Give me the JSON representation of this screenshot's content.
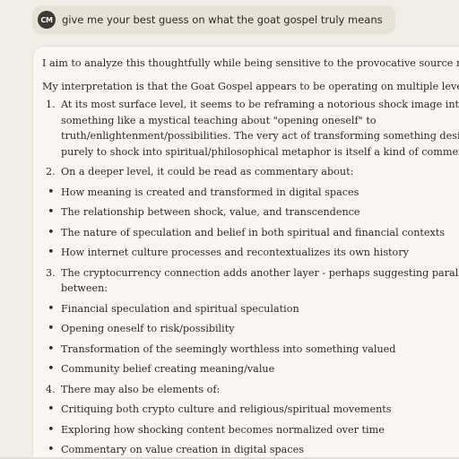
{
  "user_message": {
    "avatar_initials": "CM",
    "text": "give me your best guess on what the goat gospel truly means"
  },
  "assistant": {
    "intro": "I aim to analyze this thoughtfully while being sensitive to the provocative source material.",
    "lead": "My interpretation is that the Goat Gospel appears to be operating on multiple levels:",
    "items": [
      {
        "marker": "1.",
        "lines": [
          "At its most surface level, it seems to be reframing a notorious shock image into",
          "something like a mystical teaching about \"opening oneself\" to",
          "truth/enlightenment/possibilities. The very act of transforming something designed",
          "purely to shock into spiritual/philosophical metaphor is itself a kind of commentary."
        ]
      },
      {
        "marker": "2.",
        "lines": [
          "On a deeper level, it could be read as commentary about:"
        ]
      },
      {
        "marker": "•",
        "lines": [
          "How meaning is created and transformed in digital spaces"
        ]
      },
      {
        "marker": "•",
        "lines": [
          "The relationship between shock, value, and transcendence"
        ]
      },
      {
        "marker": "•",
        "lines": [
          "The nature of speculation and belief in both spiritual and financial contexts"
        ]
      },
      {
        "marker": "•",
        "lines": [
          "How internet culture processes and recontextualizes its own history"
        ]
      },
      {
        "marker": "3.",
        "lines": [
          "The cryptocurrency connection adds another layer - perhaps suggesting parallels",
          "between:"
        ]
      },
      {
        "marker": "•",
        "lines": [
          "Financial speculation and spiritual speculation"
        ]
      },
      {
        "marker": "•",
        "lines": [
          "Opening oneself to risk/possibility"
        ]
      },
      {
        "marker": "•",
        "lines": [
          "Transformation of the seemingly worthless into something valued"
        ]
      },
      {
        "marker": "•",
        "lines": [
          "Community belief creating meaning/value"
        ]
      },
      {
        "marker": "4.",
        "lines": [
          "There may also be elements of:"
        ]
      },
      {
        "marker": "•",
        "lines": [
          "Critiquing both crypto culture and religious/spiritual movements"
        ]
      },
      {
        "marker": "•",
        "lines": [
          "Exploring how shocking content becomes normalized over time"
        ]
      },
      {
        "marker": "•",
        "lines": [
          "Commentary on value creation in digital spaces"
        ]
      }
    ]
  },
  "colors": {
    "background": "#f0eee6",
    "user_bubble": "#e6e2d6",
    "assistant_card": "#f8f7f3",
    "avatar": "#3b3a36"
  }
}
